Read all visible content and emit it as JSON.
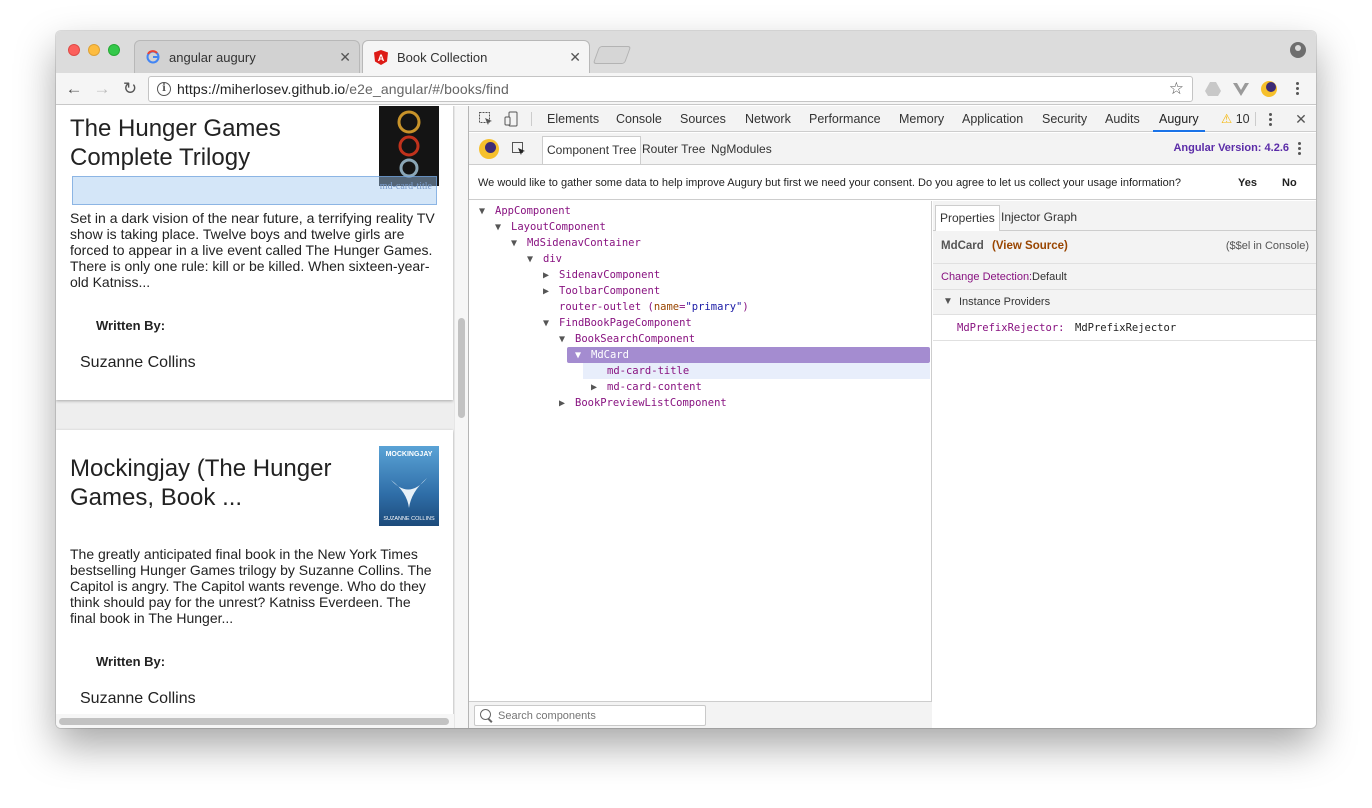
{
  "browser": {
    "tabs": [
      {
        "title": "angular augury",
        "favicon": "google-g-icon"
      },
      {
        "title": "Book Collection",
        "favicon": "angular-shield-icon"
      }
    ],
    "tab_close": "✕",
    "url_host": "https://miherlosev.github.io",
    "url_path": "/e2e_angular/#/books/find",
    "nav_icons": {
      "back": "←",
      "forward": "→",
      "reload": "↻"
    },
    "star": "☆"
  },
  "page": {
    "cards": [
      {
        "title": "The Hunger Games Complete Trilogy",
        "highlight_label": "md-card-title",
        "description": "Set in a dark vision of the near future, a terrifying reality TV show is taking place. Twelve boys and twelve girls are forced to appear in a live event called The Hunger Games. There is only one rule: kill or be killed. When sixteen-year-old Katniss...",
        "written_by": "Written By:",
        "author": "Suzanne Collins"
      },
      {
        "title": "Mockingjay (The Hunger Games, Book ...",
        "cover_text_top": "MOCKINGJAY",
        "cover_text_bottom": "SUZANNE COLLINS",
        "description": "The greatly anticipated final book in the New York Times bestselling Hunger Games trilogy by Suzanne Collins. The Capitol is angry. The Capitol wants revenge. Who do they think should pay for the unrest? Katniss Everdeen. The final book in The Hunger...",
        "written_by": "Written By:",
        "author": "Suzanne Collins"
      }
    ]
  },
  "devtools": {
    "tabs": [
      "Elements",
      "Console",
      "Sources",
      "Network",
      "Performance",
      "Memory",
      "Application",
      "Security",
      "Audits",
      "Augury"
    ],
    "active_tab": "Augury",
    "warnings": "10",
    "close": "✕",
    "augury": {
      "subtabs": [
        "Component Tree",
        "Router Tree",
        "NgModules"
      ],
      "angular_version": "Angular Version: 4.2.6",
      "consent_message": "We would like to gather some data to help improve Augury but first we need your consent. Do you agree to let us collect your usage information?",
      "consent_yes": "Yes",
      "consent_no": "No",
      "tree": [
        {
          "label": "AppComponent",
          "arrow": "▼"
        },
        {
          "label": "LayoutComponent",
          "arrow": "▼"
        },
        {
          "label": "MdSidenavContainer",
          "arrow": "▼"
        },
        {
          "label": "div",
          "arrow": "▼"
        },
        {
          "label": "SidenavComponent",
          "arrow": "▶"
        },
        {
          "label": "ToolbarComponent",
          "arrow": "▶"
        },
        {
          "label": "router-outlet",
          "attr": "name",
          "value": "\"primary\""
        },
        {
          "label": "FindBookPageComponent",
          "arrow": "▼"
        },
        {
          "label": "BookSearchComponent",
          "arrow": "▼"
        },
        {
          "label": "MdCard",
          "arrow": "▼"
        },
        {
          "label": "md-card-title"
        },
        {
          "label": "md-card-content",
          "arrow": "▶"
        },
        {
          "label": "BookPreviewListComponent",
          "arrow": "▶"
        }
      ],
      "search_placeholder": "Search components",
      "props": {
        "tabs": [
          "Properties",
          "Injector Graph"
        ],
        "component": "MdCard",
        "view_source": "(View Source)",
        "console_hint": "($$el in Console)",
        "change_detection_label": "Change Detection:",
        "change_detection_value": "Default",
        "instance_providers": "Instance Providers",
        "provider_key": "MdPrefixRejector:",
        "provider_value": "MdPrefixRejector"
      }
    }
  },
  "colors": {
    "angular_purple": "#5b2ca8",
    "selection": "#a48cd0",
    "tree_tag": "#881280",
    "view_source": "#994500"
  }
}
